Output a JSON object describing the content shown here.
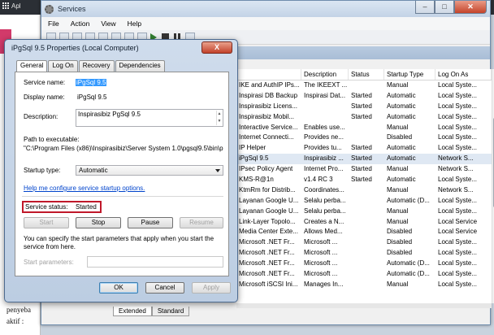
{
  "browser": {
    "apps_label": "Apl"
  },
  "doc": {
    "text_lines": [
      "penyeba",
      "aktif :"
    ]
  },
  "services_window": {
    "title": "Services",
    "menu": [
      "File",
      "Action",
      "View",
      "Help"
    ],
    "columns": [
      "",
      "Description",
      "Status",
      "Startup Type",
      "Log On As"
    ],
    "rows": [
      [
        "IKE and AuthIP IPs...",
        "The IKEEXT ...",
        "",
        "Manual",
        "Local Syste..."
      ],
      [
        "Inspirasi DB Backup",
        "Inspirasi Dat...",
        "Started",
        "Automatic",
        "Local Syste..."
      ],
      [
        "Inspirasibiz Licens...",
        "",
        "Started",
        "Automatic",
        "Local Syste..."
      ],
      [
        "Inspirasibiz Mobil...",
        "",
        "Started",
        "Automatic",
        "Local Syste..."
      ],
      [
        "Interactive Service...",
        "Enables use...",
        "",
        "Manual",
        "Local Syste..."
      ],
      [
        "Internet Connecti...",
        "Provides ne...",
        "",
        "Disabled",
        "Local Syste..."
      ],
      [
        "IP Helper",
        "Provides tu...",
        "Started",
        "Automatic",
        "Local Syste..."
      ],
      [
        "iPgSql 9.5",
        "Inspirasibiz ...",
        "Started",
        "Automatic",
        "Network S..."
      ],
      [
        "IPsec Policy Agent",
        "Internet Pro...",
        "Started",
        "Manual",
        "Network S..."
      ],
      [
        "KMS-R@1n",
        "v1.4 RC 3",
        "Started",
        "Automatic",
        "Local Syste..."
      ],
      [
        "KtmRm for Distrib...",
        "Coordinates...",
        "",
        "Manual",
        "Network S..."
      ],
      [
        "Layanan Google U...",
        "Selalu perba...",
        "",
        "Automatic (D...",
        "Local Syste..."
      ],
      [
        "Layanan Google U...",
        "Selalu perba...",
        "",
        "Manual",
        "Local Syste..."
      ],
      [
        "Link-Layer Topolo...",
        "Creates a N...",
        "",
        "Manual",
        "Local Service"
      ],
      [
        "Media Center Exte...",
        "Allows Med...",
        "",
        "Disabled",
        "Local Service"
      ],
      [
        "Microsoft .NET Fr...",
        "Microsoft ...",
        "",
        "Disabled",
        "Local Syste..."
      ],
      [
        "Microsoft .NET Fr...",
        "Microsoft ...",
        "",
        "Disabled",
        "Local Syste..."
      ],
      [
        "Microsoft .NET Fr...",
        "Microsoft ...",
        "",
        "Automatic (D...",
        "Local Syste..."
      ],
      [
        "Microsoft .NET Fr...",
        "Microsoft ...",
        "",
        "Automatic (D...",
        "Local Syste..."
      ],
      [
        "Microsoft iSCSI Ini...",
        "Manages In...",
        "",
        "Manual",
        "Local Syste..."
      ]
    ],
    "bottom_tabs": [
      "Extended",
      "Standard"
    ]
  },
  "dialog": {
    "title": "iPgSql 9.5 Properties (Local Computer)",
    "close_label": "X",
    "tabs": [
      "General",
      "Log On",
      "Recovery",
      "Dependencies"
    ],
    "service_name_label": "Service name:",
    "service_name": "iPgSql 9.5",
    "display_name_label": "Display name:",
    "display_name": "iPgSql 9.5",
    "description_label": "Description:",
    "description": "Inspirasibiz PgSql 9.5",
    "path_label": "Path to executable:",
    "path": "\"C:\\Program Files (x86)\\Inspirasibiz\\Server System 1.0\\pgsql9.5\\bin\\pg_ctl.",
    "startup_type_label": "Startup type:",
    "startup_type": "Automatic",
    "help_link": "Help me configure service startup options.",
    "service_status_label": "Service status:",
    "service_status": "Started",
    "start_label": "Start",
    "stop_label": "Stop",
    "pause_label": "Pause",
    "resume_label": "Resume",
    "params_hint": "You can specify the start parameters that apply when you start the service from here.",
    "start_params_label": "Start parameters:",
    "ok_label": "OK",
    "cancel_label": "Cancel",
    "apply_label": "Apply"
  }
}
